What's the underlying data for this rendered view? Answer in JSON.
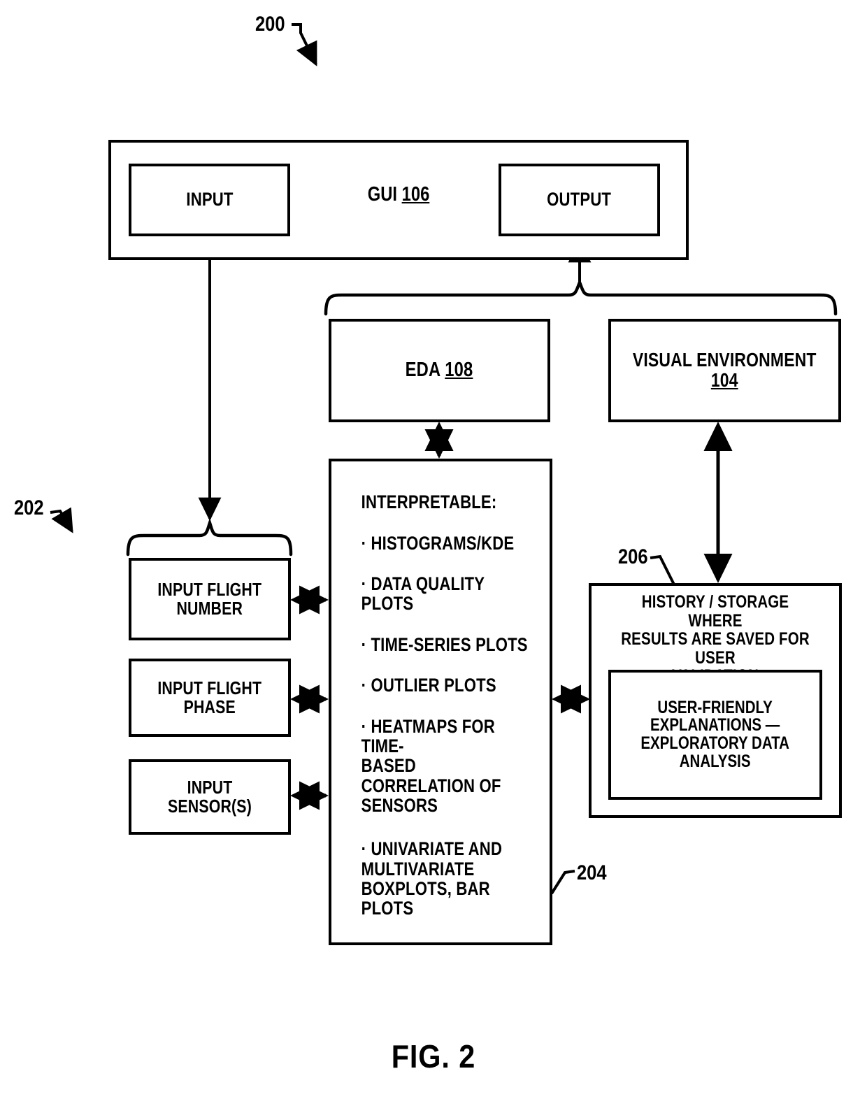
{
  "figure": {
    "caption": "FIG. 2",
    "ref_main": "200",
    "ref_inputs": "202",
    "ref_interpretable": "204",
    "ref_history": "206"
  },
  "gui": {
    "label_text": "GUI ",
    "label_ref": "106",
    "input_label": "INPUT",
    "output_label": "OUTPUT"
  },
  "modules": {
    "eda_text": "EDA ",
    "eda_ref": "108",
    "visual_env_text": "VISUAL ENVIRONMENT",
    "visual_env_ref": "104"
  },
  "interpretable": {
    "heading": "INTERPRETABLE:",
    "items": [
      "· HISTOGRAMS/KDE",
      "· DATA QUALITY PLOTS",
      "· TIME-SERIES PLOTS",
      "· OUTLIER PLOTS",
      "· HEATMAPS FOR TIME-\nBASED CORRELATION OF\nSENSORS",
      "· UNIVARIATE AND\nMULTIVARIATE\nBOXPLOTS, BAR PLOTS"
    ]
  },
  "inputs": {
    "flight_number": "INPUT FLIGHT\nNUMBER",
    "flight_phase": "INPUT FLIGHT\nPHASE",
    "sensors": "INPUT SENSOR(S)"
  },
  "history": {
    "title": "HISTORY / STORAGE WHERE\nRESULTS ARE SAVED FOR USER\nVALIDATION",
    "explanations": "USER-FRIENDLY\nEXPLANATIONS —\nEXPLORATORY DATA\nANALYSIS"
  },
  "colors": {
    "line": "#000000",
    "background": "#ffffff"
  }
}
